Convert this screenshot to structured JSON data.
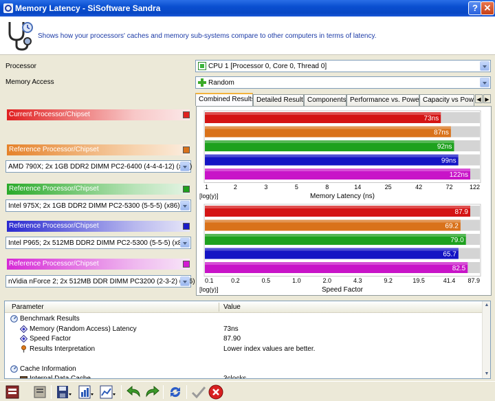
{
  "window": {
    "title": "Memory Latency - SiSoftware Sandra",
    "help_button": "?",
    "close_button": "✕"
  },
  "header": {
    "description": "Shows how your processors' caches and memory sub-systems compare to other computers in terms of latency."
  },
  "settings": {
    "processor_label": "Processor",
    "processor_value": "CPU 1 [Processor 0, Core 0, Thread 0]",
    "memory_access_label": "Memory Access",
    "memory_access_value": "Random"
  },
  "current": {
    "label": "Current Processor/Chipset",
    "color": "#e02020"
  },
  "references": [
    {
      "label": "Reference Processor/Chipset",
      "selection": "AMD 790X; 2x 1GB DDR2 DIMM PC2-6400 (4-4-4-12) (x86)",
      "color": "#d9721a"
    },
    {
      "label": "Reference Processor/Chipset",
      "selection": "Intel 975X; 2x 1GB DDR2 DIMM PC2-5300 (5-5-5) (x86)",
      "color": "#1ea11e"
    },
    {
      "label": "Reference Processor/Chipset",
      "selection": "Intel P965; 2x 512MB DDR2 DIMM PC2-5300 (5-5-5) (x86)",
      "color": "#1a1ac8"
    },
    {
      "label": "Reference Processor/Chipset",
      "selection": "nVidia nForce 2; 2x 512MB DDR DIMM PC3200 (2-3-2) (x86)",
      "color": "#d41ad4"
    }
  ],
  "tabs": [
    {
      "label": "Combined Results",
      "active": true
    },
    {
      "label": "Detailed Results",
      "active": false
    },
    {
      "label": "Components",
      "active": false
    },
    {
      "label": "Performance vs. Power",
      "active": false
    },
    {
      "label": "Capacity vs Powe",
      "active": false
    }
  ],
  "chart_data": [
    {
      "type": "bar",
      "orientation": "horizontal",
      "scale": "log",
      "xlabel": "Memory Latency (ns)",
      "scale_label": "[log(y)]",
      "xticks": [
        "1",
        "2",
        "3",
        "5",
        "8",
        "14",
        "25",
        "42",
        "72",
        "122"
      ],
      "xlim": [
        1,
        122
      ],
      "values": [
        73,
        87,
        92,
        99,
        122
      ],
      "value_labels": [
        "73ns",
        "87ns",
        "92ns",
        "99ns",
        "122ns"
      ],
      "colors": [
        "#d41414",
        "#d9721a",
        "#1ea11e",
        "#1414c4",
        "#c814c8"
      ]
    },
    {
      "type": "bar",
      "orientation": "horizontal",
      "scale": "log",
      "xlabel": "Speed Factor",
      "scale_label": "[log(y)]",
      "xticks": [
        "0.1",
        "0.2",
        "0.5",
        "1.0",
        "2.0",
        "4.3",
        "9.2",
        "19.5",
        "41.4",
        "87.9"
      ],
      "xlim": [
        0.1,
        87.9
      ],
      "values": [
        87.9,
        69.2,
        79.0,
        65.7,
        82.5
      ],
      "value_labels": [
        "87.9",
        "69.2",
        "79.0",
        "65.7",
        "82.5"
      ],
      "colors": [
        "#d41414",
        "#d9721a",
        "#1ea11e",
        "#1414c4",
        "#c814c8"
      ]
    }
  ],
  "properties": {
    "col_parameter": "Parameter",
    "col_value": "Value",
    "rows": [
      {
        "indent": 0,
        "icon": "gauge-icon",
        "param": "Benchmark Results",
        "value": ""
      },
      {
        "indent": 1,
        "icon": "diamond-icon",
        "param": "Memory (Random Access) Latency",
        "value": "73ns"
      },
      {
        "indent": 1,
        "icon": "diamond-icon",
        "param": "Speed Factor",
        "value": "87.90"
      },
      {
        "indent": 1,
        "icon": "pin-icon",
        "param": "Results Interpretation",
        "value": "Lower index values are better."
      },
      {
        "indent": 0,
        "icon": "",
        "param": "",
        "value": ""
      },
      {
        "indent": 0,
        "icon": "gauge-icon",
        "param": "Cache Information",
        "value": ""
      },
      {
        "indent": 1,
        "icon": "chip-icon",
        "param": "Internal Data Cache",
        "value": "3clocks"
      }
    ]
  }
}
